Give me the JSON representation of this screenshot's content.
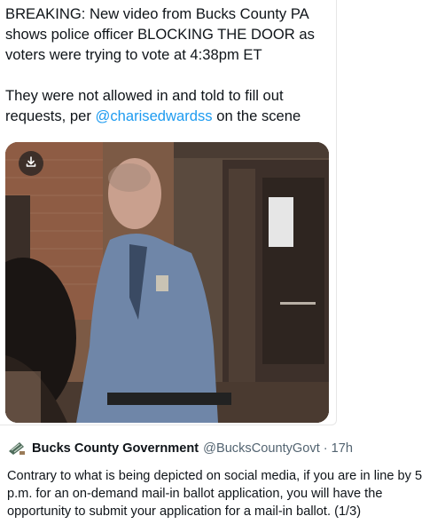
{
  "tweet": {
    "text_paragraph1": "BREAKING: New video from Bucks County PA\nshows police officer BLOCKING THE DOOR as\nvoters were trying to vote at 4:38pm ET",
    "text_paragraph2_before": "They were not allowed in and told to fill out\nrequests, per ",
    "mention": "@charisedwardss",
    "text_paragraph2_after": " on the scene",
    "media": {
      "download_icon": "download-icon"
    }
  },
  "quote_tweet": {
    "logo_icon": "county-seal-icon",
    "display_name": "Bucks County Government",
    "handle": "@BucksCountyGovt",
    "separator": "·",
    "time": "17h",
    "text": "Contrary to what is being depicted on social media, if you are in line by 5 p.m. for an on-demand mail-in ballot application, you will have the opportunity to submit your application for a mail-in ballot. (1/3)"
  },
  "colors": {
    "link": "#1d9bf0",
    "text": "#0f1419",
    "secondary_text": "#536471"
  }
}
